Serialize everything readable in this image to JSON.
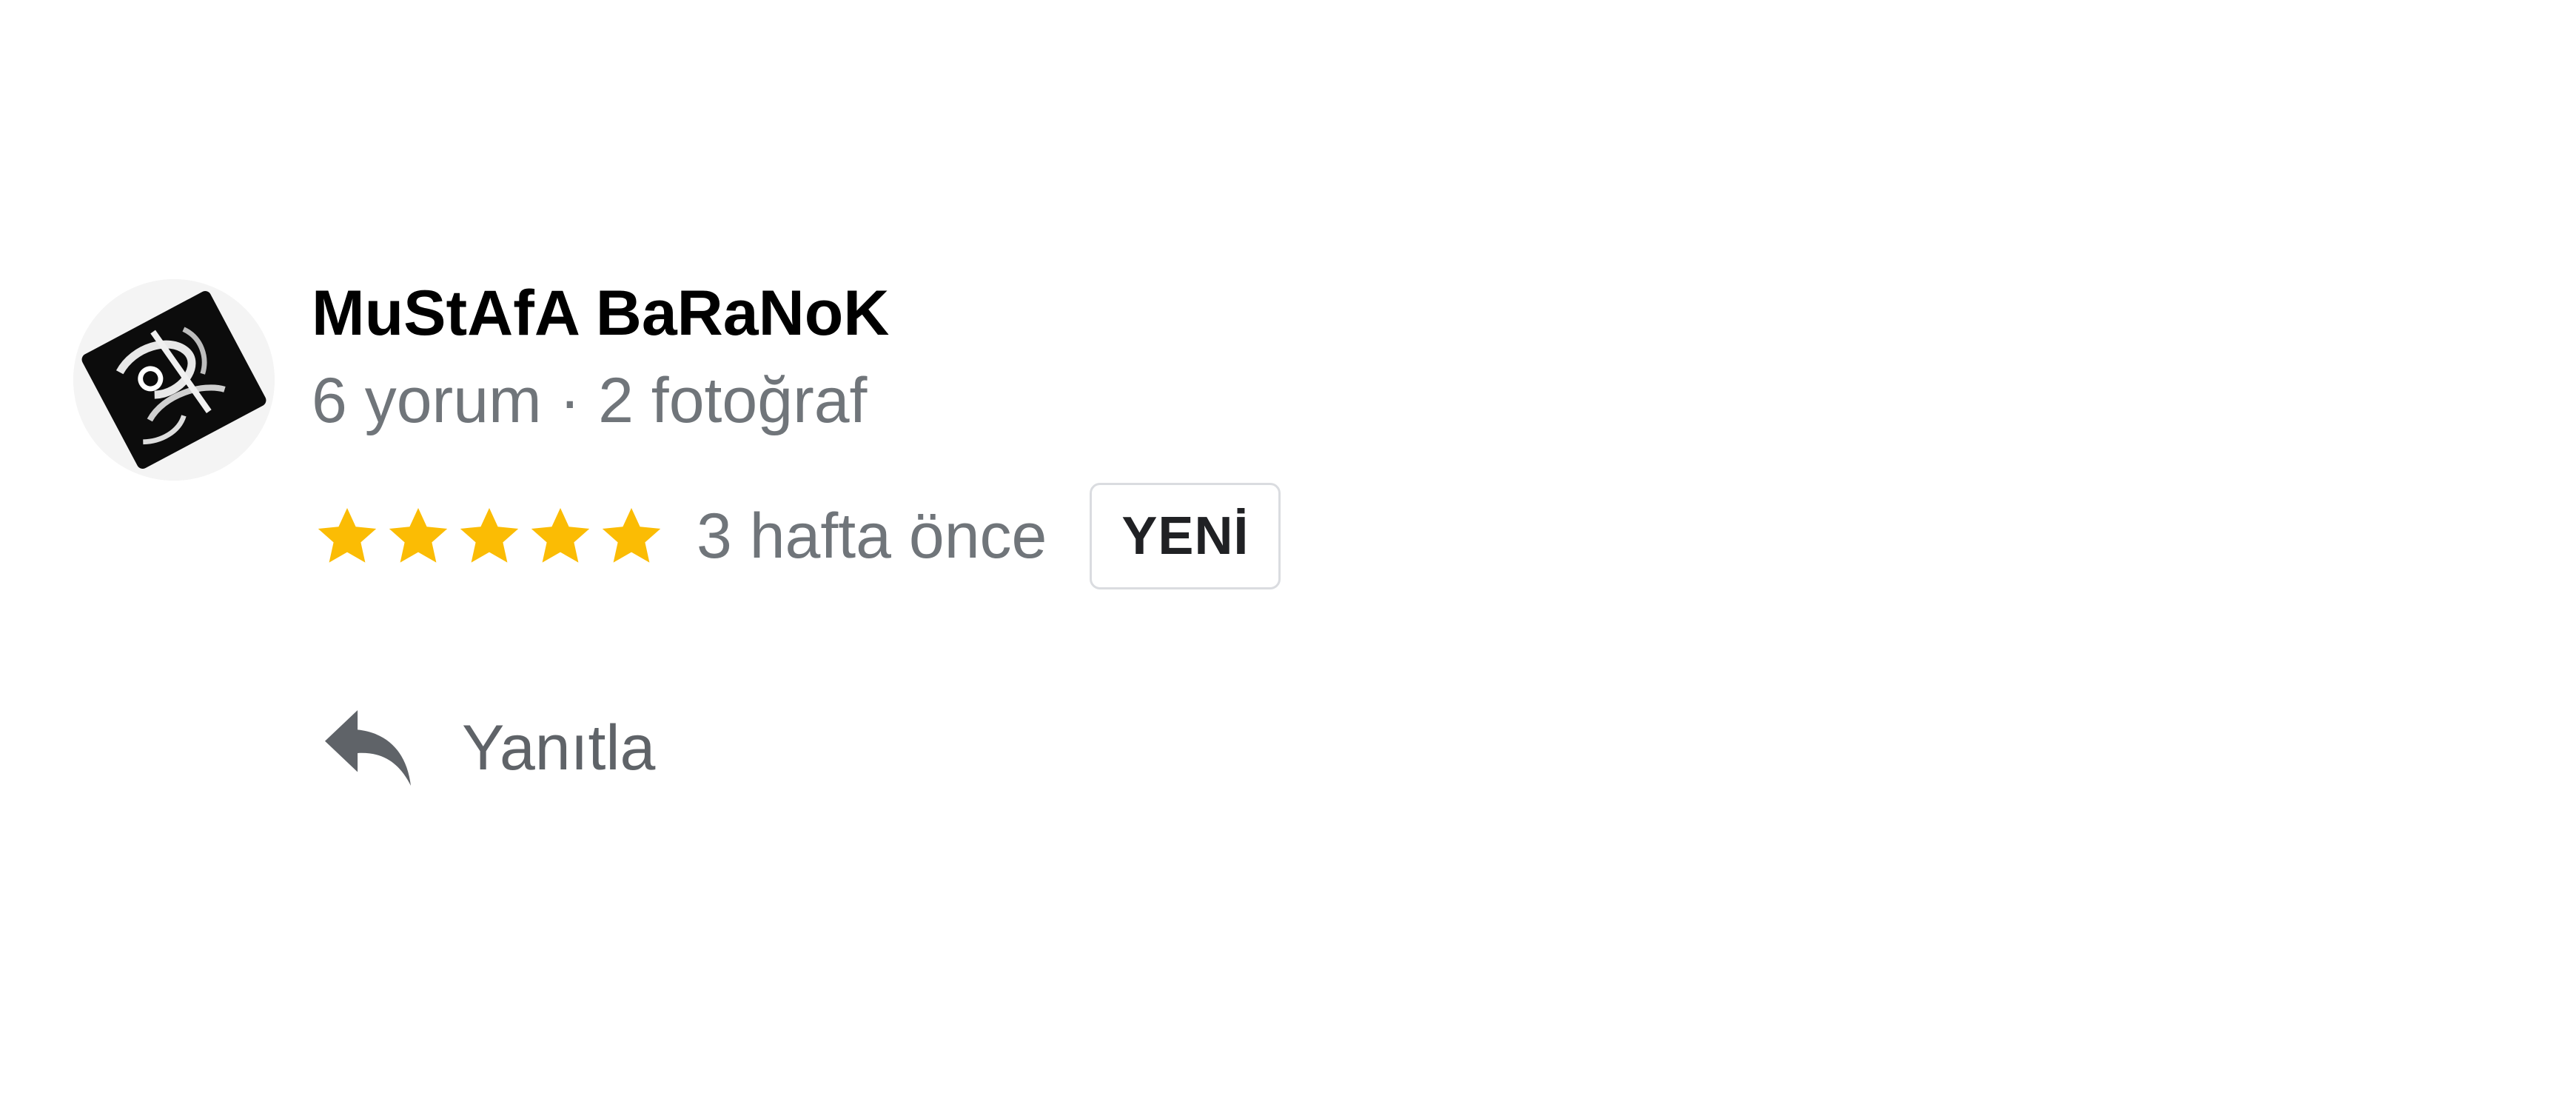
{
  "review": {
    "reviewer_name": "MuStAfA BaRaNoK",
    "reviewer_meta": "6 yorum · 2 fotoğraf",
    "rating": 5,
    "rating_max": 5,
    "time_ago": "3 hafta önce",
    "badge": "YENİ",
    "reply_label": "Yanıtla"
  },
  "icons": {
    "avatar": "profile-photo",
    "star": "star-icon",
    "reply": "reply-arrow-icon"
  },
  "colors": {
    "star": "#fbbc04",
    "name": "#000000",
    "secondary_text": "#70757a",
    "badge_border": "#dadce0",
    "reply_icon": "#5f6368"
  }
}
